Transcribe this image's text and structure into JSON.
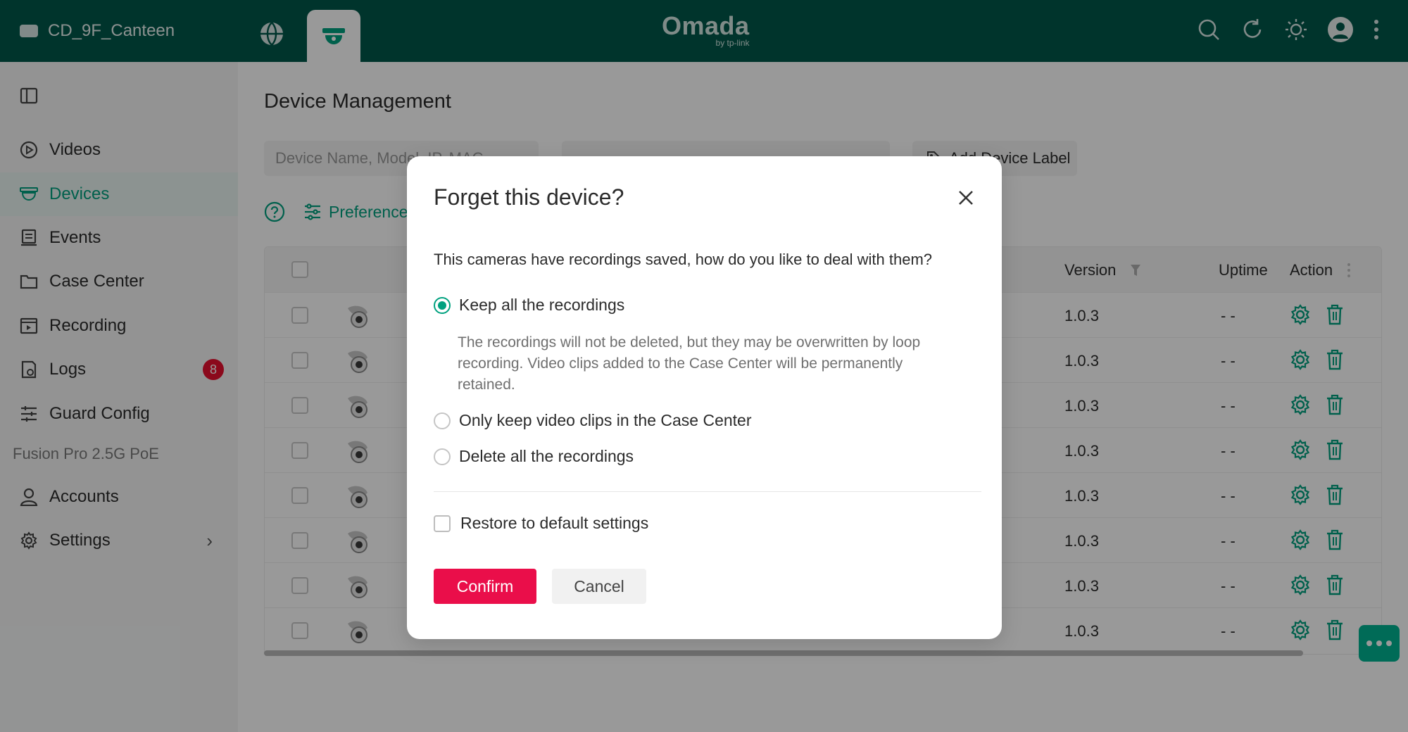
{
  "header": {
    "site_name": "CD_9F_Canteen",
    "logo_main": "Omada",
    "logo_sub": "by tp-link"
  },
  "sidebar": {
    "items": [
      {
        "label": "Videos",
        "icon": "play-circle-icon"
      },
      {
        "label": "Devices",
        "icon": "camera-dome-icon",
        "active": true
      },
      {
        "label": "Events",
        "icon": "events-icon"
      },
      {
        "label": "Case Center",
        "icon": "folder-icon"
      },
      {
        "label": "Recording",
        "icon": "recording-icon"
      },
      {
        "label": "Logs",
        "icon": "logs-icon",
        "badge": "8"
      },
      {
        "label": "Guard Config",
        "icon": "sliders-icon"
      }
    ],
    "section_label": "Fusion Pro 2.5G PoE",
    "items2": [
      {
        "label": "Accounts",
        "icon": "user-icon"
      },
      {
        "label": "Settings",
        "icon": "gear-icon"
      }
    ]
  },
  "main": {
    "title": "Device Management",
    "search_placeholder": "Device Name, Model, IP, MAC",
    "device_label_btn": "Add Device Label",
    "preferences_label": "Preferences",
    "table": {
      "headers": {
        "version": "Version",
        "uptime": "Uptime",
        "action": "Action"
      },
      "rows": [
        {
          "version": "1.0.3",
          "uptime": "- -"
        },
        {
          "version": "1.0.3",
          "uptime": "- -"
        },
        {
          "version": "1.0.3",
          "uptime": "- -"
        },
        {
          "version": "1.0.3",
          "uptime": "- -"
        },
        {
          "version": "1.0.3",
          "uptime": "- -"
        },
        {
          "version": "1.0.3",
          "uptime": "- -"
        },
        {
          "version": "1.0.3",
          "uptime": "- -"
        },
        {
          "version": "1.0.3",
          "uptime": "- -"
        }
      ]
    }
  },
  "modal": {
    "title": "Forget this device?",
    "description": "This cameras have recordings saved, how do you like to deal with them?",
    "options": [
      {
        "label": "Keep all the recordings",
        "checked": true
      },
      {
        "label": "Only keep video clips in the Case Center",
        "checked": false
      },
      {
        "label": "Delete all the recordings",
        "checked": false
      }
    ],
    "option_desc": "The recordings will not be deleted, but they may be overwritten by loop recording. Video clips added to the Case Center will be permanently retained.",
    "restore_label": "Restore to default settings",
    "confirm_label": "Confirm",
    "cancel_label": "Cancel"
  },
  "colors": {
    "header_bg": "#00584a",
    "accent": "#00a17f",
    "confirm": "#ea0e4a",
    "badge": "#e8102f"
  }
}
